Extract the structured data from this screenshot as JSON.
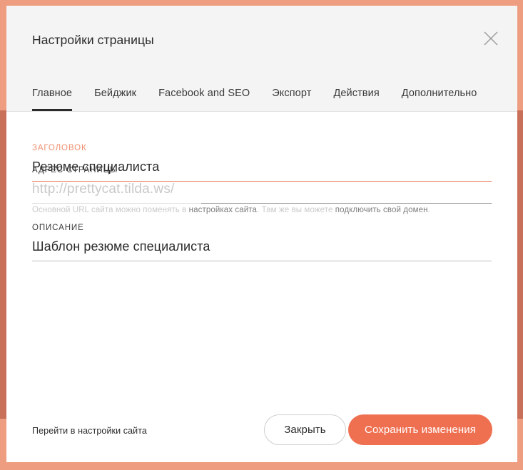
{
  "theme": {
    "accent": "#ef7051",
    "accent_light": "#ef9d80",
    "accent_dark": "#c8705a",
    "label_accent": "#ef8f6e",
    "header_bg": "#f4f4f4",
    "text": "#2b2b2b",
    "muted": "#c9c9c9"
  },
  "header": {
    "title": "Настройки страницы",
    "close_icon": "close-icon",
    "tabs": [
      {
        "label": "Главное",
        "active": true
      },
      {
        "label": "Бейджик",
        "active": false
      },
      {
        "label": "Facebook and SEO",
        "active": false
      },
      {
        "label": "Экспорт",
        "active": false
      },
      {
        "label": "Действия",
        "active": false
      },
      {
        "label": "Дополнительно",
        "active": false
      }
    ]
  },
  "form": {
    "title_field": {
      "label": "ЗАГОЛОВОК",
      "value": "Резюме специалиста",
      "focused": true
    },
    "description_field": {
      "label": "ОПИСАНИЕ",
      "value": "Шаблон резюме специалиста",
      "focused": false
    },
    "url_field": {
      "label": "АДРЕС СТРАНИЦЫ",
      "prefix": "http://prettycat.tilda.ws/",
      "value": "",
      "placeholder": ""
    },
    "hint": {
      "part1": "Основной URL сайта можно поменять в ",
      "link1": "настройках сайта",
      "part2": ". Там же вы можете ",
      "link2": "подключить свой домен",
      "part3": "."
    }
  },
  "footer": {
    "site_settings_link": "Перейти в настройки сайта",
    "close_label": "Закрыть",
    "save_label": "Сохранить изменения"
  }
}
